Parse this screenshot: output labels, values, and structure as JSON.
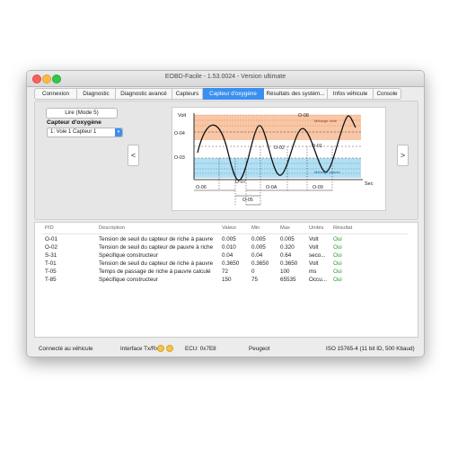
{
  "window": {
    "title": "EOBD-Facile - 1.53.0024 - Version ultimate"
  },
  "tabs": [
    "Connexion",
    "Diagnostic",
    "Diagnostic avancé",
    "Capteurs",
    "Capteur d'oxygène",
    "Résultats des systèm...",
    "Infos véhicule",
    "Console"
  ],
  "active_tab": "Capteur d'oxygène",
  "controls": {
    "read_button": "Lire (Mode 5)",
    "sensor_label": "Capteur d'oxygène",
    "sensor_select": "1: Voie 1 Capteur 1",
    "prev_glyph": "<",
    "next_glyph": ">"
  },
  "graph": {
    "volt_label": "Volt",
    "sec_label": "Sec",
    "rich_label": "Mélange riche",
    "lean_label": "Mélange pauvre",
    "markers": {
      "o08": "O-08",
      "o04": "O-04",
      "o02": "O-02",
      "o01": "O-01",
      "o03": "O-03",
      "o06": "O-06",
      "o05": "O-05",
      "o07": "O-07",
      "o0a": "O-0A",
      "o09": "O-09"
    },
    "colors": {
      "rich": "#f6b48a",
      "lean": "#9ad4ee",
      "curve": "#111111"
    }
  },
  "table": {
    "headers": {
      "pid": "PID",
      "desc": "Description",
      "val": "Valeur",
      "min": "Min",
      "max": "Max",
      "unit": "Unités",
      "res": "Résultat"
    },
    "rows": [
      {
        "pid": "O-01",
        "desc": "Tension de seuil du capteur de riche à pauvre",
        "val": "0.005",
        "min": "0.005",
        "max": "0.005",
        "unit": "Volt",
        "res": "Oui"
      },
      {
        "pid": "O-02",
        "desc": "Tension de seuil du capteur de pauvre à riche",
        "val": "0.010",
        "min": "0.005",
        "max": "0.320",
        "unit": "Volt",
        "res": "Oui"
      },
      {
        "pid": "S-31",
        "desc": "Spécifique constructeur",
        "val": "0.04",
        "min": "0.04",
        "max": "0.64",
        "unit": "seco...",
        "res": "Oui"
      },
      {
        "pid": "T-01",
        "desc": "Tension de seuil du capteur de riche à pauvre",
        "val": "0.3650",
        "min": "0.3650",
        "max": "0.3650",
        "unit": "Volt",
        "res": "Oui"
      },
      {
        "pid": "T-05",
        "desc": "Temps de passage de riche à pauvre calculé",
        "val": "72",
        "min": "0",
        "max": "100",
        "unit": "ms",
        "res": "Oui"
      },
      {
        "pid": "T-85",
        "desc": "Spécifique constructeur",
        "val": "150",
        "min": "75",
        "max": "65535",
        "unit": "Occu...",
        "res": "Oui"
      }
    ]
  },
  "status": {
    "connection": "Connecté au véhicule",
    "interface": "Interface Tx/Rx",
    "ecu": "ECU: 0x7E8",
    "brand": "Peugeot",
    "protocol": "ISO 15765-4 (11 bit ID, 500 Kbaud)"
  }
}
